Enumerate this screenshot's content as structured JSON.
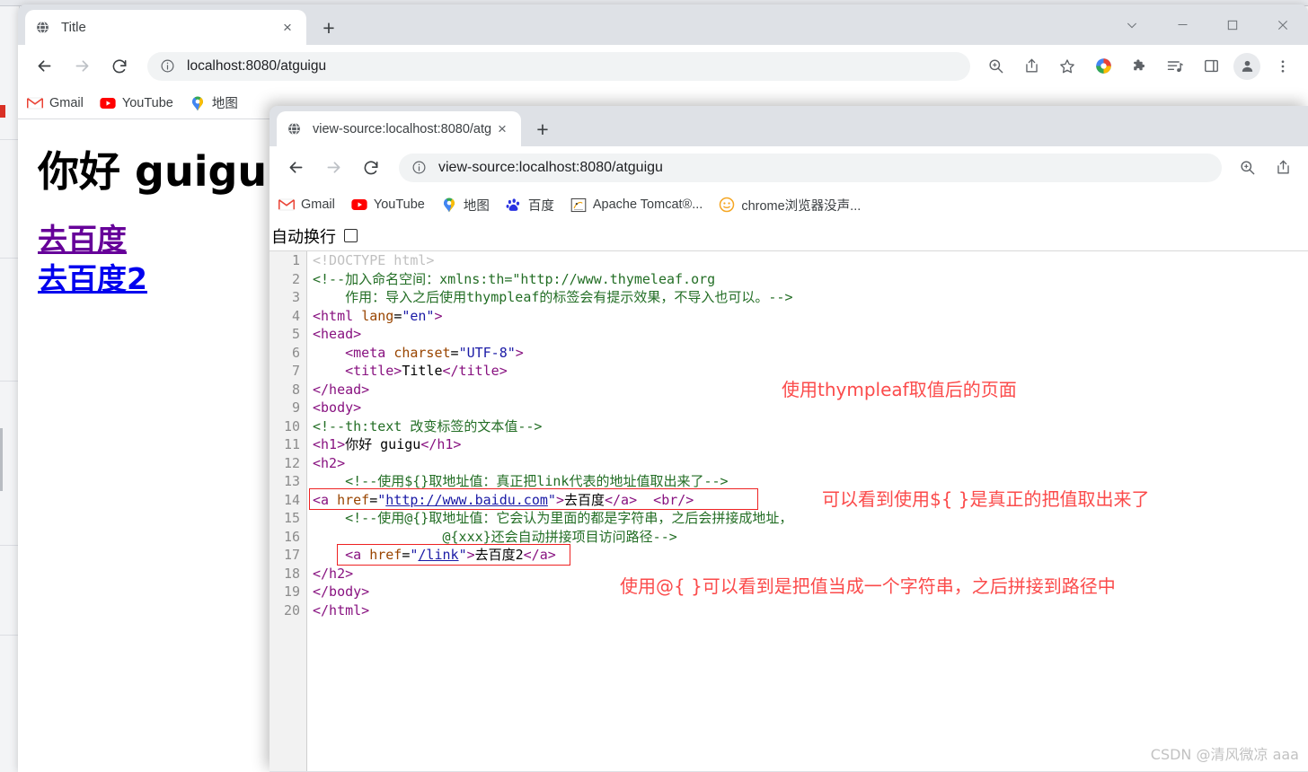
{
  "back_window": {
    "tab": {
      "title": "Title",
      "favicon": "globe-icon",
      "close": "×"
    },
    "new_tab": "+",
    "window_controls": {
      "minimize_group": "⌄",
      "minimize": "—",
      "maximize": "□",
      "close": "×"
    },
    "toolbar": {
      "back": "←",
      "forward": "→",
      "reload": "⟳",
      "url": "localhost:8080/atguigu",
      "icons": [
        "zoom-icon",
        "share-icon",
        "bookmark-star-icon",
        "google-lens-icon",
        "extensions-puzzle-icon",
        "media-list-icon",
        "side-panel-icon",
        "profile-avatar-icon",
        "chrome-menu-icon"
      ]
    },
    "bookmarks": [
      {
        "label": "Gmail",
        "icon": "gmail-icon"
      },
      {
        "label": "YouTube",
        "icon": "youtube-icon"
      },
      {
        "label": "地图",
        "icon": "maps-pin-icon"
      }
    ],
    "page": {
      "heading": "你好 guigu",
      "link1": "去百度",
      "link2": "去百度2"
    }
  },
  "front_window": {
    "tab": {
      "title": "view-source:localhost:8080/atg",
      "favicon": "globe-icon",
      "close": "×"
    },
    "new_tab": "+",
    "toolbar": {
      "back": "←",
      "forward": "→",
      "reload": "⟳",
      "url": "view-source:localhost:8080/atguigu",
      "url_prefix": "view-source:",
      "icons": [
        "zoom-icon",
        "share-icon"
      ]
    },
    "bookmarks": [
      {
        "label": "Gmail",
        "icon": "gmail-icon"
      },
      {
        "label": "YouTube",
        "icon": "youtube-icon"
      },
      {
        "label": "地图",
        "icon": "maps-pin-icon"
      },
      {
        "label": "百度",
        "icon": "baidu-icon"
      },
      {
        "label": "Apache Tomcat®...",
        "icon": "tomcat-icon"
      },
      {
        "label": "chrome浏览器没声...",
        "icon": "orange-face-icon"
      }
    ],
    "wrap_bar": {
      "label": "自动换行",
      "checked": false
    },
    "source": {
      "line_numbers": [
        "1",
        "2",
        "3",
        "4",
        "5",
        "6",
        "7",
        "8",
        "9",
        "10",
        "11",
        "12",
        "13",
        "14",
        "15",
        "16",
        "17",
        "18",
        "19",
        "20"
      ],
      "lines": [
        "<!DOCTYPE html>",
        "<!--加入命名空间：xmlns:th=\"http://www.thymeleaf.org",
        "    作用：导入之后使用thympleaf的标签会有提示效果，不导入也可以。-->",
        "<html lang=\"en\">",
        "<head>",
        "    <meta charset=\"UTF-8\">",
        "    <title>Title</title>",
        "</head>",
        "<body>",
        "<!--th:text 改变标签的文本值-->",
        "<h1>你好 guigu</h1>",
        "<h2>",
        "    <!--使用${}取地址值：真正把link代表的地址值取出来了-->",
        "<a href=\"http://www.baidu.com\">去百度</a>  <br/>",
        "    <!--使用@{}取地址值：它会认为里面的都是字符串，之后会拼接成地址，",
        "                @{xxx}还会自动拼接项目访问路径-->",
        "    <a href=\"/link\">去百度2</a>",
        "</h2>",
        "</body>",
        "</html>"
      ]
    },
    "annotations": [
      {
        "text": "使用thympleaf取值后的页面",
        "color": "#fb4b4b"
      },
      {
        "text": "可以看到使用${ }是真正的把值取出来了",
        "color": "#fb4b4b"
      },
      {
        "text": "使用@{ }可以看到是把值当成一个字符串，之后拼接到路径中",
        "color": "#fb4b4b"
      }
    ],
    "watermark": "CSDN @清风微凉 aaa"
  }
}
